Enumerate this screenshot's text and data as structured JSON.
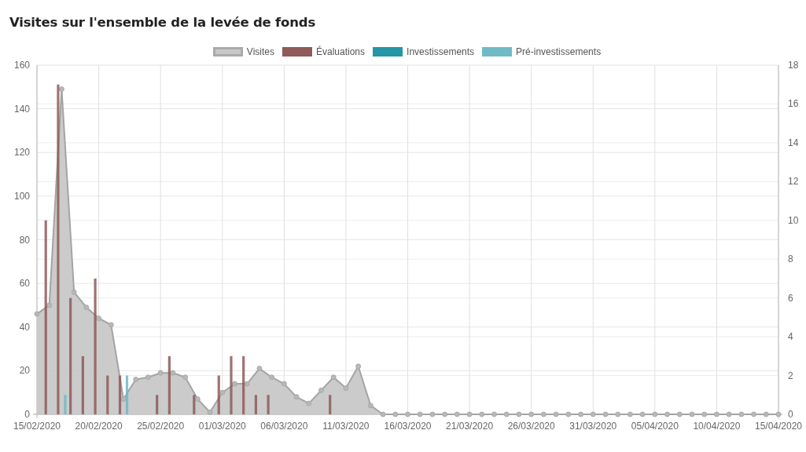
{
  "title": "Visites sur l'ensemble de la levée de fonds",
  "chart": {
    "chart_data": {
      "type": "bar",
      "categories": [
        "15/02/2020",
        null,
        null,
        null,
        null,
        "20/02/2020",
        null,
        null,
        null,
        null,
        "25/02/2020",
        null,
        null,
        null,
        null,
        "01/03/2020",
        null,
        null,
        null,
        null,
        "06/03/2020",
        null,
        null,
        null,
        null,
        "11/03/2020",
        null,
        null,
        null,
        null,
        "16/03/2020",
        null,
        null,
        null,
        null,
        "21/03/2020",
        null,
        null,
        null,
        null,
        "26/03/2020",
        null,
        null,
        null,
        null,
        "31/03/2020",
        null,
        null,
        null,
        null,
        "05/04/2020",
        null,
        null,
        null,
        null,
        "10/04/2020",
        null,
        null,
        null,
        null,
        "15/04/2020"
      ],
      "grid": true,
      "ylim": [
        0,
        160
      ],
      "yticks": [
        0,
        20,
        40,
        60,
        80,
        100,
        120,
        140,
        160
      ],
      "y2lim": [
        0,
        18
      ],
      "y2ticks": [
        0,
        2,
        4,
        6,
        8,
        10,
        12,
        14,
        16,
        18
      ],
      "series": [
        {
          "name": "Visites",
          "type": "area",
          "color": "#c8c8c8",
          "values": [
            46,
            50,
            149,
            56,
            49,
            44,
            41,
            7,
            16,
            17,
            19,
            19,
            17,
            7,
            1,
            10,
            14,
            14,
            21,
            17,
            14,
            8,
            5,
            11,
            17,
            12,
            22,
            4,
            0,
            0,
            0,
            0,
            0,
            0,
            0,
            0,
            0,
            0,
            0,
            0,
            0,
            0,
            0,
            0,
            0,
            0,
            0,
            0,
            0,
            0,
            0,
            0,
            0,
            0,
            0,
            0,
            0,
            0,
            0,
            0,
            0
          ]
        },
        {
          "name": "Évaluations",
          "type": "bar",
          "axis": "y2",
          "color": "#8e5a5a",
          "values": [
            0,
            10,
            17,
            6,
            3,
            7,
            2,
            2,
            0,
            0,
            1,
            3,
            0,
            1,
            0,
            2,
            3,
            3,
            1,
            1,
            0,
            0,
            0,
            0,
            1,
            0,
            0,
            0,
            0,
            0,
            0,
            0,
            0,
            0,
            0,
            0,
            0,
            0,
            0,
            0,
            0,
            0,
            0,
            0,
            0,
            0,
            0,
            0,
            0,
            0,
            0,
            0,
            0,
            0,
            0,
            0,
            0,
            0,
            0,
            0,
            0
          ]
        },
        {
          "name": "Investissements",
          "type": "bar",
          "axis": "y2",
          "color": "#2596a6",
          "values": [
            0,
            0,
            0,
            0,
            0,
            0,
            0,
            0,
            0,
            0,
            0,
            0,
            0,
            0,
            0,
            0,
            0,
            0,
            0,
            0,
            0,
            0,
            0,
            0,
            0,
            0,
            0,
            0,
            0,
            0,
            0,
            0,
            0,
            0,
            0,
            0,
            0,
            0,
            0,
            0,
            0,
            0,
            0,
            0,
            0,
            0,
            0,
            0,
            0,
            0,
            0,
            0,
            0,
            0,
            0,
            0,
            0,
            0,
            0,
            0,
            0
          ]
        },
        {
          "name": "Pré-investissements",
          "type": "bar",
          "axis": "y2",
          "color": "#6fbac5",
          "values": [
            0,
            0,
            1,
            0,
            0,
            0,
            0,
            2,
            0,
            0,
            0,
            0,
            0,
            0,
            0,
            0,
            0,
            0,
            0,
            0,
            0,
            0,
            0,
            0,
            0,
            0,
            0,
            0,
            0,
            0,
            0,
            0,
            0,
            0,
            0,
            0,
            0,
            0,
            0,
            0,
            0,
            0,
            0,
            0,
            0,
            0,
            0,
            0,
            0,
            0,
            0,
            0,
            0,
            0,
            0,
            0,
            0,
            0,
            0,
            0,
            0
          ]
        }
      ]
    }
  }
}
